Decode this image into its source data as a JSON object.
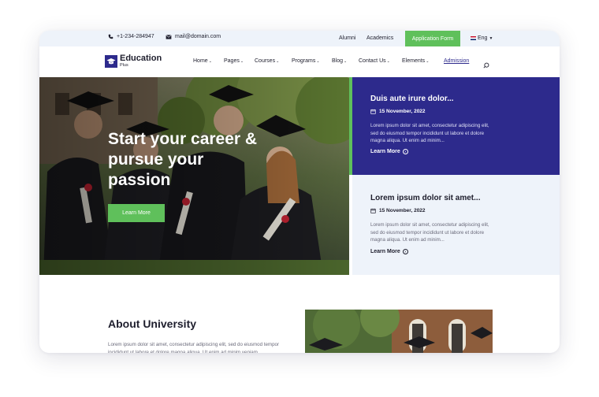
{
  "topbar": {
    "phone": "+1-234-284947",
    "email": "mail@domain.com",
    "links": [
      "Alumni",
      "Academics"
    ],
    "apply_label": "Application Form",
    "language": "Eng"
  },
  "logo": {
    "main": "Education",
    "sub": "Plus"
  },
  "nav": {
    "items": [
      "Home",
      "Pages",
      "Courses",
      "Programs",
      "Blog",
      "Contact Us",
      "Elements"
    ],
    "admission": "Admission"
  },
  "hero": {
    "title": "Start your career & pursue your passion",
    "button": "Learn More"
  },
  "news": [
    {
      "title": "Duis aute irure dolor...",
      "date": "15 November, 2022",
      "text": "Lorem ipsum dolor sit amet, consectetur adipiscing elit, sed do eiusmod tempor incididunt ut labore et dolore magna aliqua. Ut enim ad minim...",
      "more": "Learn More"
    },
    {
      "title": "Lorem ipsum dolor sit amet...",
      "date": "15 November, 2022",
      "text": "Lorem ipsum dolor sit amet, consectetur adipiscing elit, sed do eiusmod tempor incididunt ut labore et dolore magna aliqua. Ut enim ad minim...",
      "more": "Learn More"
    }
  ],
  "about": {
    "title": "About University",
    "text": "Lorem ipsum dolor sit amet, consectetur adipiscing elit, sed do eiusmod tempor incididunt ut labore et dolore magna aliqua. Ut enim ad minim veniam"
  },
  "colors": {
    "brand_navy": "#2d2a8c",
    "accent_green": "#5fc05b",
    "light_bg": "#eef3fa"
  },
  "icons": [
    "phone-icon",
    "mail-icon",
    "flag-icon",
    "chevron-down-icon",
    "search-icon",
    "graduation-cap-icon",
    "calendar-icon",
    "arrow-right-circle-icon"
  ]
}
